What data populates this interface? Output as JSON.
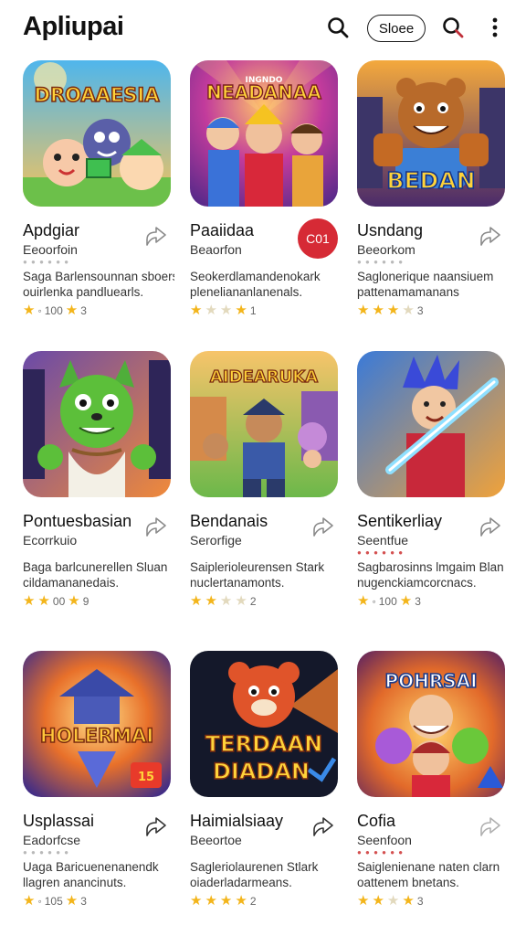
{
  "header": {
    "title": "Apliupai",
    "sort_label": "Sloee"
  },
  "apps": [
    {
      "name": "Apdgiar",
      "developer": "Eeoorfoin",
      "desc1": "Saga Barlensounnan sboers",
      "desc2": "ouirlenka pandluearls.",
      "rating_text": "100",
      "rating_extra": "3"
    },
    {
      "name": "Paaiidaa",
      "developer": "Beaorfon",
      "desc1": "Seokerdlamandenokark",
      "desc2": "pleneliananlanenals.",
      "rating_text": "",
      "rating_extra": "1",
      "badge": "C01"
    },
    {
      "name": "Usndang",
      "developer": "Beeorkom",
      "desc1": "Saglonerique naansiuem",
      "desc2": "pattenamamanans",
      "rating_text": "",
      "rating_extra": "3"
    },
    {
      "name": "Pontuesbasian",
      "developer": "Ecorrkuio",
      "desc1": "Baga barlcunerellen Sluan",
      "desc2": "cildamananedais.",
      "rating_text": "00",
      "rating_extra": "9"
    },
    {
      "name": "Bendanais",
      "developer": "Serorfige",
      "desc1": "Saiplerioleurensen Stark",
      "desc2": "nuclertanamonts.",
      "rating_text": "",
      "rating_extra": "2"
    },
    {
      "name": "Sentikerliay",
      "developer": "Seentfue",
      "desc1": "Sagbarosinns lmgaim Blan",
      "desc2": "nugenckiamcorcnacs.",
      "rating_text": "100",
      "rating_extra": "3"
    },
    {
      "name": "Usplassai",
      "developer": "Eadorfcse",
      "desc1": "Uaga Baricuenenanendk",
      "desc2": "llagren anancinuts.",
      "rating_text": "105",
      "rating_extra": "3"
    },
    {
      "name": "Haimialsiaay",
      "developer": "Beeortoe",
      "desc1": "Sagleriolaurenen Stlark",
      "desc2": "oiaderladarmeans.",
      "rating_text": "",
      "rating_extra": "2"
    },
    {
      "name": "Cofia",
      "developer": "Seenfoon",
      "desc1": "Saiglenienane naten clarn",
      "desc2": "oattenem bnetans.",
      "rating_text": "",
      "rating_extra": "3"
    }
  ],
  "thumb_text": {
    "a0": "DROAAESIA",
    "a1": "NEADANAA",
    "a1_top": "INGNDO",
    "a2": "BEDAN",
    "a4": "AIDEARUKA",
    "a6": "HOLERMAI",
    "a6_tag": "15",
    "a7_line1": "TERDAAN",
    "a7_line2": "DIADAN",
    "a8": "POHRSAI"
  },
  "colors": {
    "accent_red": "#d62a35",
    "star": "#f3b51b"
  }
}
